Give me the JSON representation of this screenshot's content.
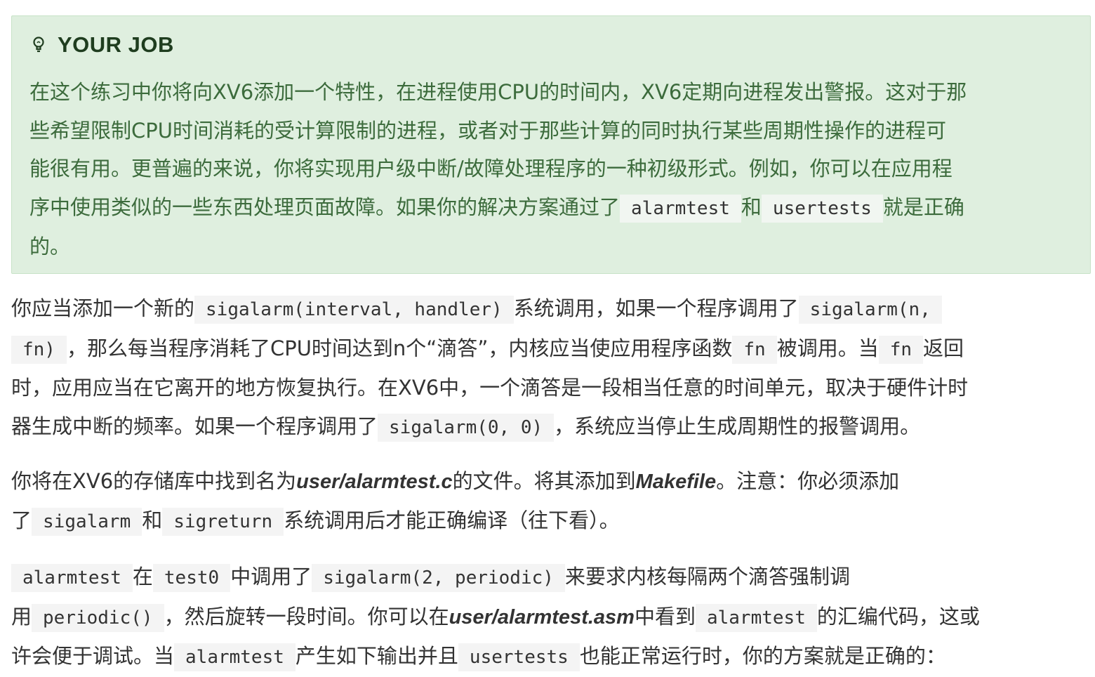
{
  "job": {
    "title": "YOUR JOB",
    "icon": "lightbulb-icon",
    "l1": "在这个练习中你将向XV6添加一个特性，在进程使用CPU的时间内，XV6定期向进程发出警报。这对于那",
    "l2": "些希望限制CPU时间消耗的受计算限制的进程，或者对于那些计算的同时执行某些周期性操作的进程可",
    "l3": "能很有用。更普遍的来说，你将实现用户级中断/故障处理程序的一种初级形式。例如，你可以在应用程",
    "l4a": "序中使用类似的一些东西处理页面故障。如果你的解决方案通过了",
    "c_alarmtest": "alarmtest",
    "and": "和",
    "c_usertests": "usertests",
    "l4b": "就是正确",
    "l5": "的。"
  },
  "p1": {
    "t1": "你应当添加一个新的",
    "c1": "sigalarm(interval, handler)",
    "t2": "系统调用，如果一个程序调用了",
    "c2a": "sigalarm(n,",
    "c2b": "fn)",
    "t3": "，那么每当程序消耗了CPU时间达到n个“滴答”，内核应当使应用程序函数",
    "c3": "fn",
    "t4": "被调用。当",
    "c4": "fn",
    "t5": "返回",
    "t6": "时，应用应当在它离开的地方恢复执行。在XV6中，一个滴答是一段相当任意的时间单元，取决于硬件计时",
    "t7": "器生成中断的频率。如果一个程序调用了",
    "c5": "sigalarm(0, 0)",
    "t8": "，系统应当停止生成周期性的报警调用。"
  },
  "p2": {
    "t1": "你将在XV6的存储库中找到名为",
    "f1": "user/alarmtest.c",
    "t2": "的文件。将其添加到",
    "f2": "Makefile",
    "t3": "。注意：你必须添加",
    "t4": "了",
    "c1": "sigalarm",
    "t5": "和",
    "c2": "sigreturn",
    "t6": "系统调用后才能正确编译（往下看）。"
  },
  "p3": {
    "c1": "alarmtest",
    "t1": "在",
    "c2": "test0",
    "t2": "中调用了",
    "c3": "sigalarm(2, periodic)",
    "t3": "来要求内核每隔两个滴答强制调",
    "t4": "用",
    "c4": "periodic()",
    "t5": "，然后旋转一段时间。你可以在",
    "f1": "user/alarmtest.asm",
    "t6": "中看到",
    "c5": "alarmtest",
    "t7": "的汇编代码，这或",
    "t8": "许会便于调试。当",
    "c6": "alarmtest",
    "t9": "产生如下输出并且",
    "c7": "usertests",
    "t10": "也能正常运行时，你的方案就是正确的："
  }
}
